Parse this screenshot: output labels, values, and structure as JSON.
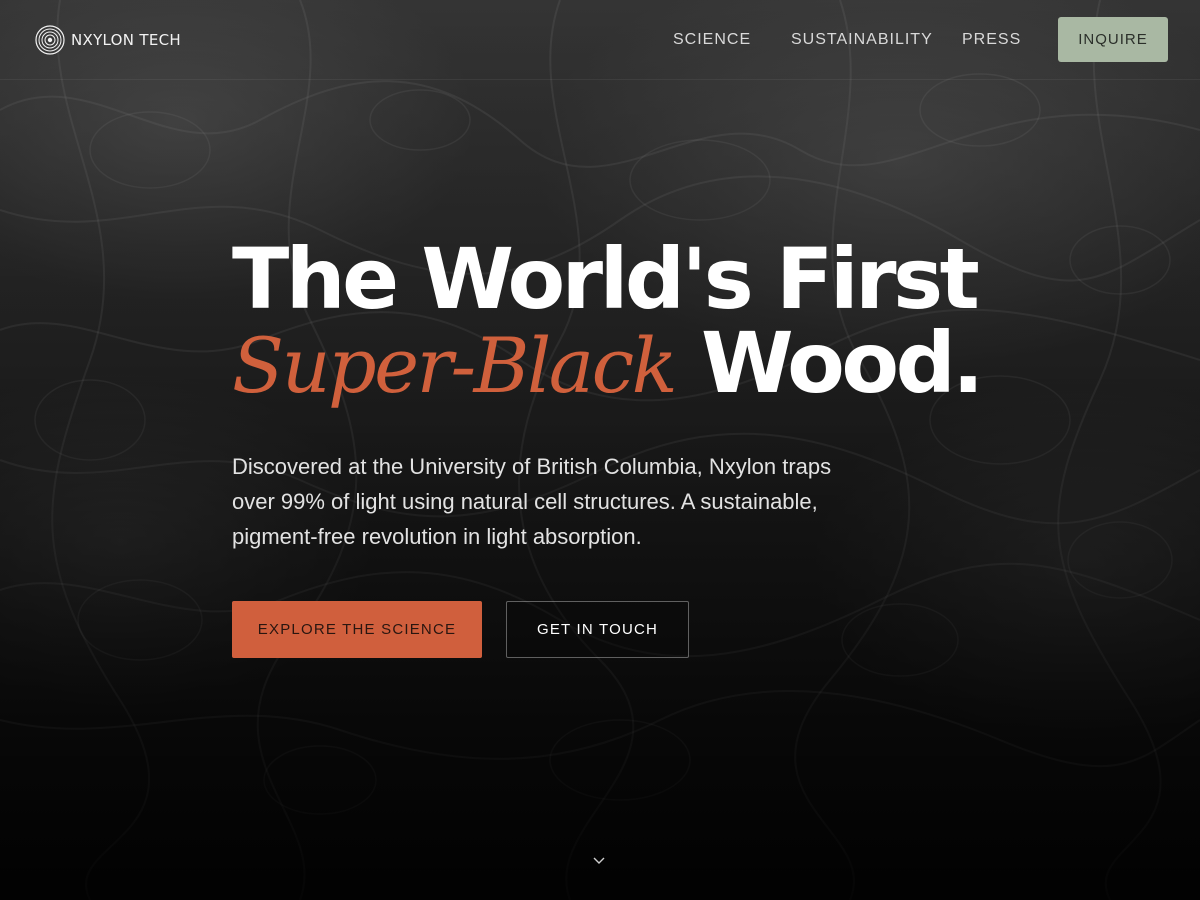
{
  "brand": {
    "name": "NXYLON TECH",
    "logo_icon": "concentric-rings-logo"
  },
  "nav": {
    "items": [
      {
        "label": "SCIENCE"
      },
      {
        "label": "SUSTAINABILITY"
      },
      {
        "label": "PRESS"
      }
    ],
    "cta_label": "INQUIRE"
  },
  "hero": {
    "headline_line1": "The World's First",
    "headline_accent": "Super-Black",
    "headline_rest": "Wood.",
    "subtitle": "Discovered at the University of British Columbia, Nxylon traps over 99% of light using natural cell structures. A sustainable, pigment-free revolution in light absorption.",
    "primary_button": "EXPLORE THE SCIENCE",
    "secondary_button": "GET IN TOUCH",
    "scroll_icon": "chevron-down-icon"
  },
  "colors": {
    "accent": "#d0603c",
    "button_primary": "#d05f3d",
    "inquire_button": "#a9b8a3",
    "background": "#1b1b1b",
    "text": "#ffffff"
  }
}
